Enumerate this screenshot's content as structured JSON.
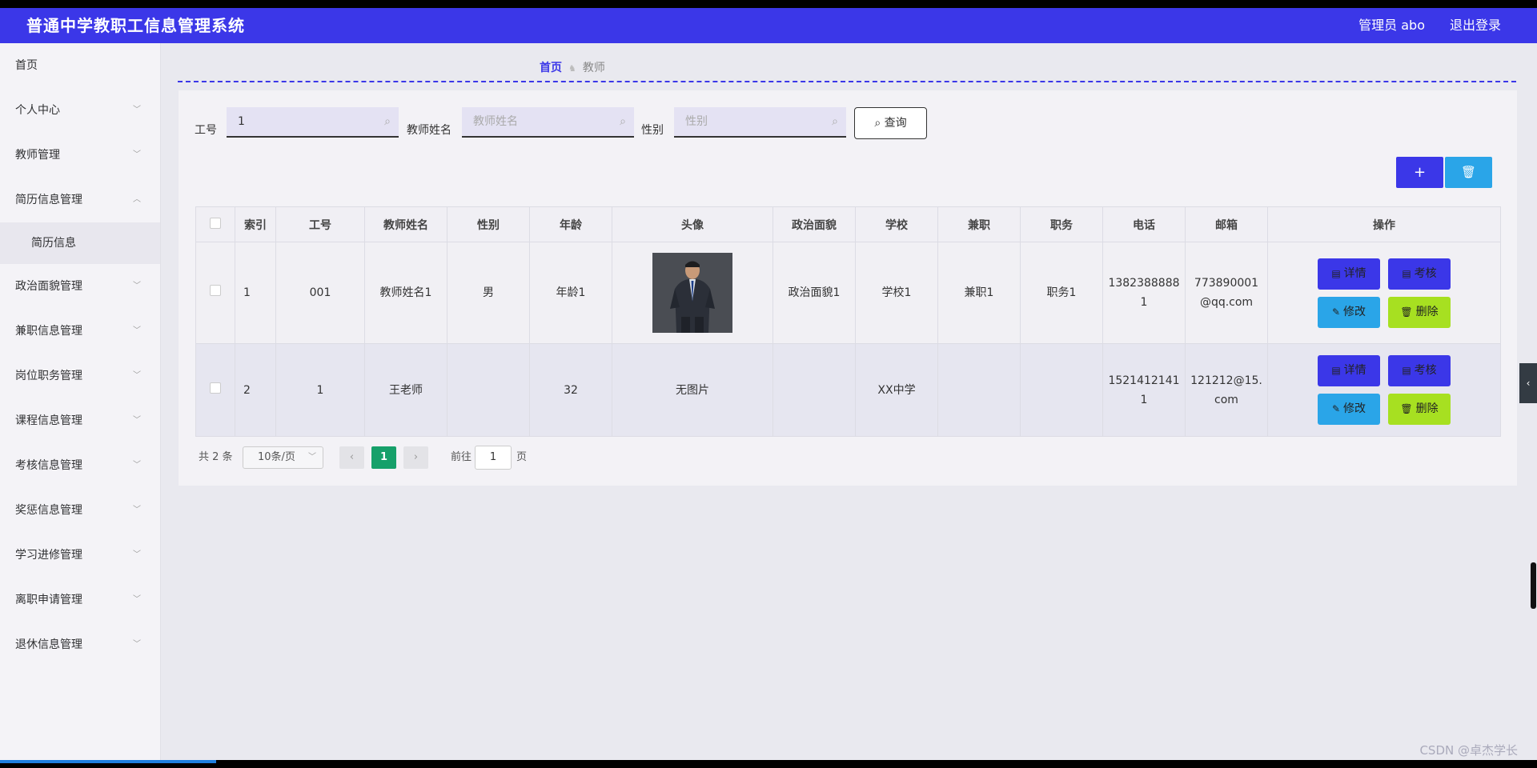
{
  "header": {
    "title": "普通中学教职工信息管理系统",
    "admin": "管理员 abo",
    "logout": "退出登录"
  },
  "sidebar": {
    "items": [
      {
        "label": "首页"
      },
      {
        "label": "个人中心"
      },
      {
        "label": "教师管理"
      },
      {
        "label": "简历信息管理"
      },
      {
        "label": "政治面貌管理"
      },
      {
        "label": "兼职信息管理"
      },
      {
        "label": "岗位职务管理"
      },
      {
        "label": "课程信息管理"
      },
      {
        "label": "考核信息管理"
      },
      {
        "label": "奖惩信息管理"
      },
      {
        "label": "学习进修管理"
      },
      {
        "label": "离职申请管理"
      },
      {
        "label": "退休信息管理"
      }
    ],
    "sub_label": "简历信息"
  },
  "breadcrumb": {
    "home": "首页",
    "current": "教师"
  },
  "search": {
    "id_label": "工号",
    "id_value": "1",
    "name_label": "教师姓名",
    "name_placeholder": "教师姓名",
    "gender_label": "性别",
    "gender_placeholder": "性别",
    "query_label": "查询"
  },
  "table": {
    "headers": [
      "索引",
      "工号",
      "教师姓名",
      "性别",
      "年龄",
      "头像",
      "政治面貌",
      "学校",
      "兼职",
      "职务",
      "电话",
      "邮箱",
      "操作"
    ],
    "rows": [
      {
        "index": "1",
        "id": "001",
        "name": "教师姓名1",
        "gender": "男",
        "age": "年龄1",
        "avatar": "",
        "politics": "政治面貌1",
        "school": "学校1",
        "parttime": "兼职1",
        "position": "职务1",
        "phone": "13823888881",
        "email": "773890001@qq.com"
      },
      {
        "index": "2",
        "id": "1",
        "name": "王老师",
        "gender": "",
        "age": "32",
        "avatar": "无图片",
        "politics": "",
        "school": "XX中学",
        "parttime": "",
        "position": "",
        "phone": "15214121411",
        "email": "121212@15.com"
      }
    ],
    "actions": {
      "detail": "详情",
      "assess": "考核",
      "edit": "修改",
      "delete": "删除"
    }
  },
  "pagination": {
    "total": "共 2 条",
    "page_size": "10条/页",
    "current": "1",
    "goto_label": "前往",
    "goto_value": "1",
    "page_unit": "页"
  },
  "watermark": "CSDN @卓杰学长",
  "colors": {
    "primary": "#3b37e8",
    "info": "#2aa5e8",
    "danger": "#a7e021",
    "page_active": "#16a06a"
  }
}
